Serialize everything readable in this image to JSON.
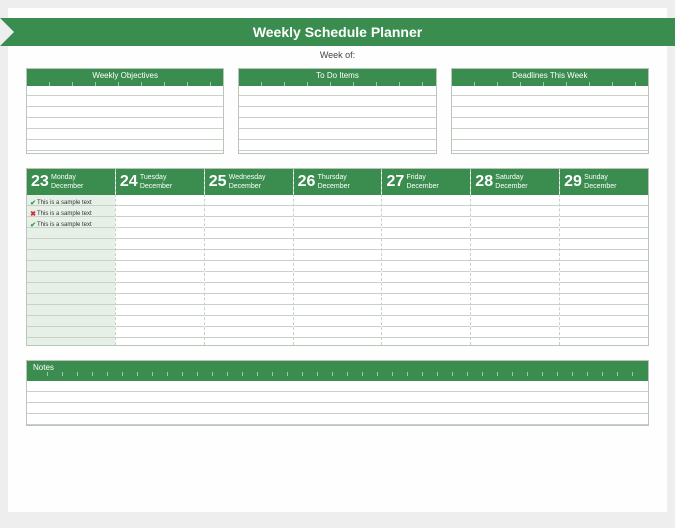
{
  "title": "Weekly Schedule Planner",
  "week_of_label": "Week of:",
  "cards": {
    "objectives": "Weekly Objectives",
    "todo": "To Do Items",
    "deadlines": "Deadlines This Week"
  },
  "days": [
    {
      "num": "23",
      "dow": "Monday",
      "month": "December"
    },
    {
      "num": "24",
      "dow": "Tuesday",
      "month": "December"
    },
    {
      "num": "25",
      "dow": "Wednesday",
      "month": "December"
    },
    {
      "num": "26",
      "dow": "Thursday",
      "month": "December"
    },
    {
      "num": "27",
      "dow": "Friday",
      "month": "December"
    },
    {
      "num": "28",
      "dow": "Saturday",
      "month": "December"
    },
    {
      "num": "29",
      "dow": "Sunday",
      "month": "December"
    }
  ],
  "entries": [
    {
      "icon": "check",
      "text": "This is a sample text"
    },
    {
      "icon": "cross",
      "text": "This is a sample text"
    },
    {
      "icon": "check",
      "text": "This is a sample text"
    }
  ],
  "notes_label": "Notes",
  "icons": {
    "check": "✔",
    "cross": "✖"
  }
}
